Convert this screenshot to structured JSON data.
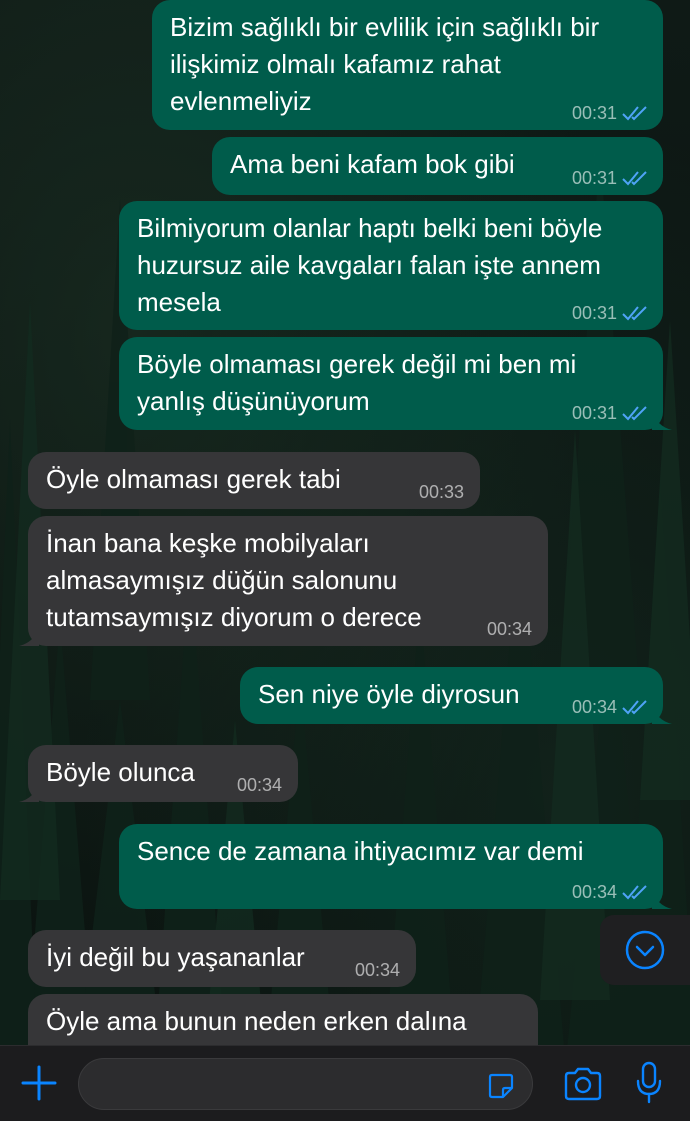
{
  "messages": [
    {
      "dir": "out",
      "text": "Bizim sağlıklı bir evlilik için sağlıklı bir\nilişkimiz olmalı kafamız rahat\nevlenmeliyiz",
      "time": "00:31",
      "read": true
    },
    {
      "dir": "out",
      "text": "Ama beni kafam bok gibi",
      "time": "00:31",
      "read": true
    },
    {
      "dir": "out",
      "text": "Bilmiyorum olanlar haptı belki beni böyle\nhuzursuz aile kavgaları falan işte annem\nmesela",
      "time": "00:31",
      "read": true
    },
    {
      "dir": "out",
      "text": "Böyle olmaması gerek değil mi ben mi\nyanlış düşünüyorum",
      "time": "00:31",
      "read": true
    },
    {
      "dir": "in",
      "text": "Öyle olmaması gerek tabi",
      "time": "00:33"
    },
    {
      "dir": "in",
      "text": "İnan bana keşke mobilyaları\nalmasaymışız düğün salonunu\ntutamsaymışız diyorum o derece",
      "time": "00:34"
    },
    {
      "dir": "out",
      "text": "Sen niye öyle diyrosun",
      "time": "00:34",
      "read": true
    },
    {
      "dir": "in",
      "text": "Böyle olunca",
      "time": "00:34"
    },
    {
      "dir": "out",
      "text": "Sence de zamana ihtiyacımız var demi",
      "time": "00:34",
      "read": true
    },
    {
      "dir": "in",
      "text": "İyi değil bu yaşananlar",
      "time": "00:34"
    },
    {
      "dir": "in",
      "text": "Öyle ama bunun neden erken dalına",
      "time": ""
    }
  ],
  "composer": {
    "placeholder": "",
    "value": ""
  },
  "icons": {
    "attach": "plus-icon",
    "sticker": "sticker-icon",
    "camera": "camera-icon",
    "mic": "microphone-icon",
    "scroll": "chevron-down-circle-icon",
    "read_receipt": "double-check-icon"
  },
  "colors": {
    "outgoing_bubble": "#005c4b",
    "incoming_bubble": "#363638",
    "accent": "#0a84ff",
    "read_ticks": "#4fa3f7"
  }
}
